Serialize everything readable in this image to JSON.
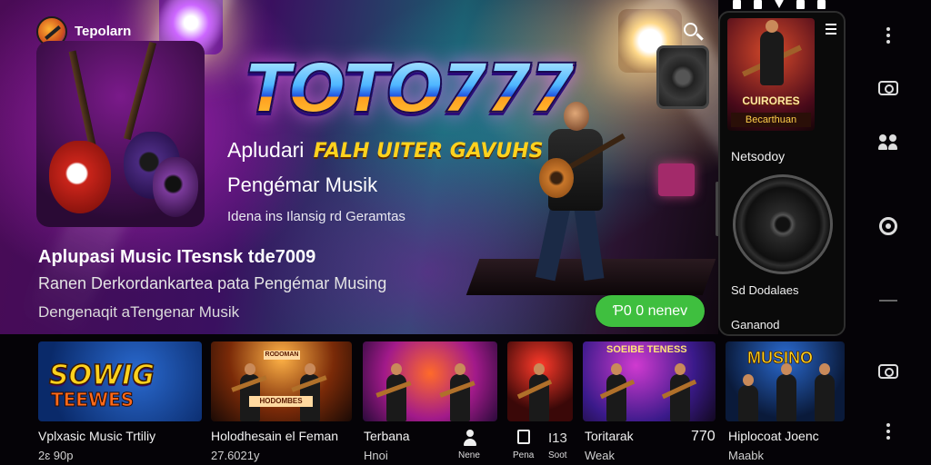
{
  "app": {
    "name": "Tepolarn"
  },
  "hero": {
    "logo_text": "TOTO777",
    "tagline_line1_prefix": "Apludari",
    "tagline_line1_highlight": "FALH UITER GAVUHS",
    "tagline_line2": "Pengémar Musik",
    "tagline_line3": "Idena ins Ilansig rd Geramtas",
    "title": "Aplupasi Music ITesnsk tde7009",
    "subtitle": "Ranen Derkordankartea pata Pengémar Musing",
    "description": "Dengenaqit aTengenar Musik",
    "cta_label": "Ƥ0 0 nenev"
  },
  "side_panel": {
    "album_title": "CUIRORES",
    "album_subtitle": "Becarthuan",
    "label_1": "Netsodoy",
    "label_2": "Sd Dodalaes",
    "label_3": "Gananod"
  },
  "cards": [
    {
      "label": "Vplxasic Music Trtiliy",
      "sub": "2ɛ 90p",
      "art_text": "SOWIG",
      "art_text2": "TEEWES"
    },
    {
      "label": "Holodhesain el Feman",
      "sub": "27.6021y",
      "art_text": "RODOMAN",
      "art_text2": "HODOMBES"
    },
    {
      "label": "Terbana",
      "sub": "Hnoi"
    },
    {
      "label": "Pena",
      "sub": ""
    },
    {
      "label": "Toritarak",
      "sub": "Weak",
      "art_text": "SOEIBE TENESS",
      "meta": "770"
    },
    {
      "label": "Hiplocoat Joenc",
      "sub": "Maabk",
      "art_text": "MUSINO"
    }
  ],
  "bottom_nav": {
    "item1_label": "Nene",
    "item2_label": "Pena",
    "item3_label": "Soot",
    "item3_title": "I13"
  },
  "colors": {
    "accent": "#3fbf3f",
    "highlight": "#ffd21e",
    "background": "#050307"
  },
  "icons": [
    "search-icon",
    "more-vert-icon",
    "camera-icon",
    "people-icon",
    "target-icon",
    "menu-icon",
    "speaker-icon",
    "person-icon",
    "document-icon"
  ]
}
